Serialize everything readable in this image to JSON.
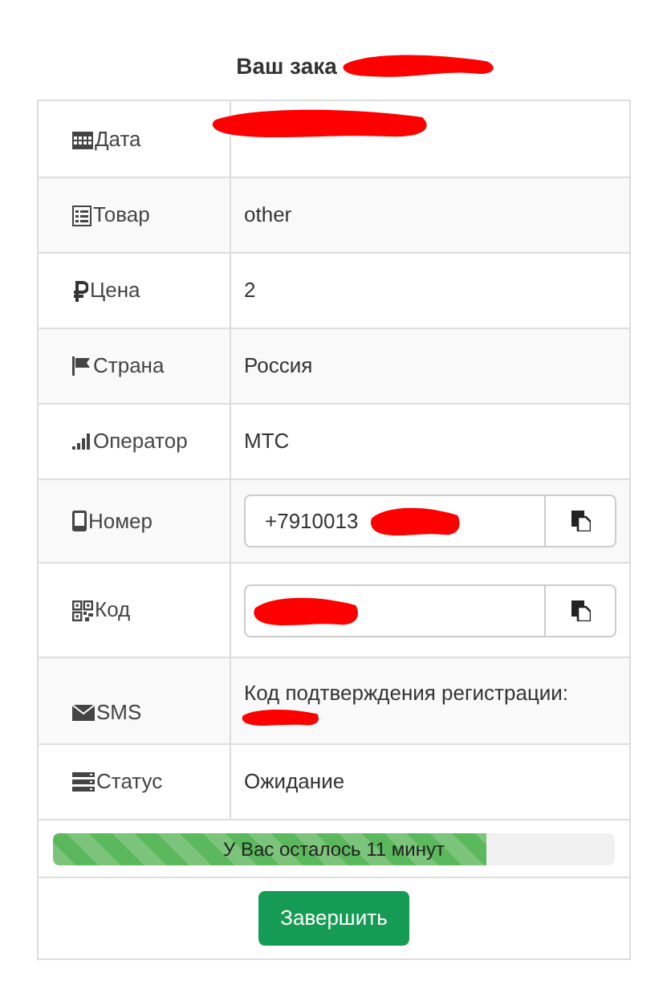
{
  "title": "Ваш зака",
  "rows": [
    {
      "kind": "text",
      "label": "Дата",
      "redacted": true
    },
    {
      "kind": "text",
      "label": "Товар",
      "value": "other"
    },
    {
      "kind": "text",
      "label": "Цена",
      "value": "2"
    },
    {
      "kind": "text",
      "label": "Страна",
      "value": "Россия"
    },
    {
      "kind": "text",
      "label": "Оператор",
      "value": "МТС"
    },
    {
      "kind": "copy",
      "label": "Номер",
      "value": "+7910013",
      "redacted": true
    },
    {
      "kind": "copy",
      "label": "Код",
      "redacted": true
    },
    {
      "kind": "text",
      "label": "SMS",
      "value": "Код подтверждения регистрации:",
      "redacted": true
    },
    {
      "kind": "text",
      "label": "Статус",
      "value": "Ожидание"
    }
  ],
  "progress": {
    "label": "У Вас осталось 11 минут",
    "level": 0.77
  },
  "button": "Завершить"
}
